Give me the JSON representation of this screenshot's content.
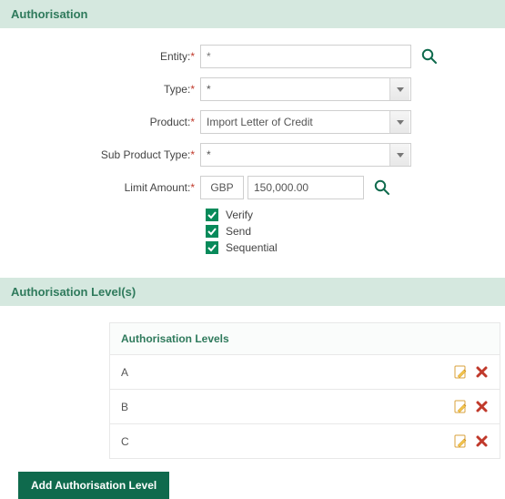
{
  "sections": {
    "authorisation_header": "Authorisation",
    "levels_header": "Authorisation Level(s)"
  },
  "form": {
    "entity": {
      "label": "Entity:",
      "placeholder": "*",
      "value": ""
    },
    "type": {
      "label": "Type:",
      "value": "*"
    },
    "product": {
      "label": "Product:",
      "value": "Import Letter of Credit"
    },
    "sub_product_type": {
      "label": "Sub Product Type:",
      "value": "*"
    },
    "limit_amount": {
      "label": "Limit Amount:",
      "currency": "GBP",
      "value": "150,000.00"
    },
    "checks": {
      "verify": "Verify",
      "send": "Send",
      "sequential": "Sequential"
    }
  },
  "levels_table": {
    "header": "Authorisation Levels",
    "rows": [
      {
        "level": "A"
      },
      {
        "level": "B"
      },
      {
        "level": "C"
      }
    ]
  },
  "buttons": {
    "add_level": "Add Authorisation Level"
  },
  "icons": {
    "lookup": "search-icon",
    "dropdown": "chevron-down-icon",
    "edit": "edit-icon",
    "delete": "delete-icon",
    "checked": "check-icon"
  },
  "colors": {
    "accent": "#0f6a4d",
    "header_bg": "#d5e8df",
    "header_text": "#2f7a5c",
    "danger": "#c0392b"
  }
}
